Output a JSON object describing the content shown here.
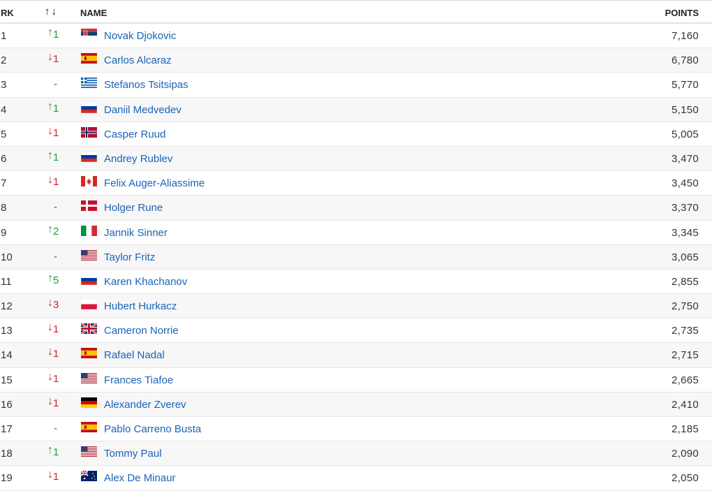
{
  "header": {
    "rank": "RK",
    "move_icon": "↑↓",
    "name": "NAME",
    "points": "POINTS"
  },
  "rows": [
    {
      "rank": "1",
      "dir": "up",
      "delta": "1",
      "flag": "serbia",
      "name": "Novak Djokovic",
      "points": "7,160"
    },
    {
      "rank": "2",
      "dir": "down",
      "delta": "1",
      "flag": "spain",
      "name": "Carlos Alcaraz",
      "points": "6,780"
    },
    {
      "rank": "3",
      "dir": "none",
      "delta": "-",
      "flag": "greece",
      "name": "Stefanos Tsitsipas",
      "points": "5,770"
    },
    {
      "rank": "4",
      "dir": "up",
      "delta": "1",
      "flag": "russia",
      "name": "Daniil Medvedev",
      "points": "5,150"
    },
    {
      "rank": "5",
      "dir": "down",
      "delta": "1",
      "flag": "norway",
      "name": "Casper Ruud",
      "points": "5,005"
    },
    {
      "rank": "6",
      "dir": "up",
      "delta": "1",
      "flag": "russia",
      "name": "Andrey Rublev",
      "points": "3,470"
    },
    {
      "rank": "7",
      "dir": "down",
      "delta": "1",
      "flag": "canada",
      "name": "Felix Auger-Aliassime",
      "points": "3,450"
    },
    {
      "rank": "8",
      "dir": "none",
      "delta": "-",
      "flag": "denmark",
      "name": "Holger Rune",
      "points": "3,370"
    },
    {
      "rank": "9",
      "dir": "up",
      "delta": "2",
      "flag": "italy",
      "name": "Jannik Sinner",
      "points": "3,345"
    },
    {
      "rank": "10",
      "dir": "none",
      "delta": "-",
      "flag": "usa",
      "name": "Taylor Fritz",
      "points": "3,065"
    },
    {
      "rank": "11",
      "dir": "up",
      "delta": "5",
      "flag": "russia",
      "name": "Karen Khachanov",
      "points": "2,855"
    },
    {
      "rank": "12",
      "dir": "down",
      "delta": "3",
      "flag": "poland",
      "name": "Hubert Hurkacz",
      "points": "2,750"
    },
    {
      "rank": "13",
      "dir": "down",
      "delta": "1",
      "flag": "uk",
      "name": "Cameron Norrie",
      "points": "2,735"
    },
    {
      "rank": "14",
      "dir": "down",
      "delta": "1",
      "flag": "spain",
      "name": "Rafael Nadal",
      "points": "2,715"
    },
    {
      "rank": "15",
      "dir": "down",
      "delta": "1",
      "flag": "usa",
      "name": "Frances Tiafoe",
      "points": "2,665"
    },
    {
      "rank": "16",
      "dir": "down",
      "delta": "1",
      "flag": "germany",
      "name": "Alexander Zverev",
      "points": "2,410"
    },
    {
      "rank": "17",
      "dir": "none",
      "delta": "-",
      "flag": "spain",
      "name": "Pablo Carreno Busta",
      "points": "2,185"
    },
    {
      "rank": "18",
      "dir": "up",
      "delta": "1",
      "flag": "usa",
      "name": "Tommy Paul",
      "points": "2,090"
    },
    {
      "rank": "19",
      "dir": "down",
      "delta": "1",
      "flag": "australia",
      "name": "Alex De Minaur",
      "points": "2,050"
    }
  ],
  "colors": {
    "up": "#1f9a3a",
    "down": "#d0202a",
    "link": "#1a63b8"
  }
}
